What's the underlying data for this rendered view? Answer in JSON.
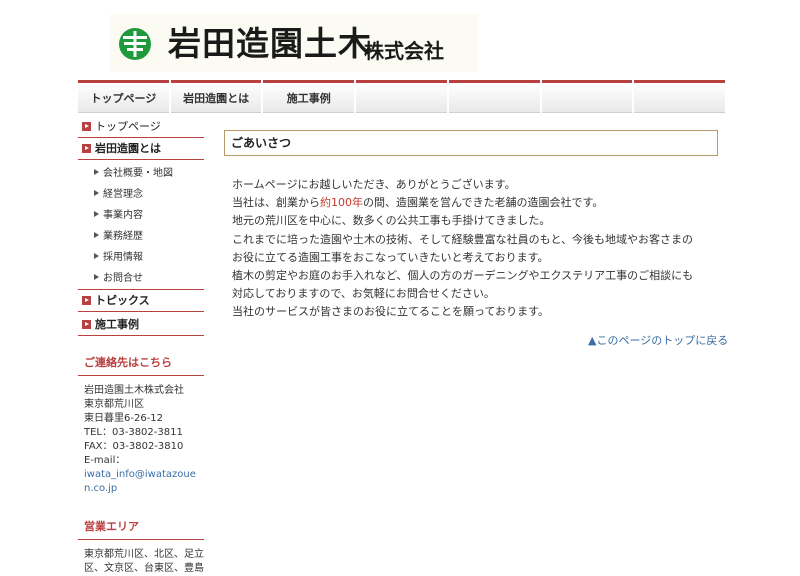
{
  "header": {
    "company_name": "岩田造園土木",
    "company_suffix": "株式会社",
    "logo_icon": "company-crest"
  },
  "nav": {
    "items": [
      "トップページ",
      "岩田造園とは",
      "施工事例",
      "",
      "",
      "",
      ""
    ]
  },
  "sidebar": {
    "links": [
      {
        "label": "トップページ",
        "bold": false
      },
      {
        "label": "岩田造園とは",
        "bold": true
      }
    ],
    "sub_links": [
      "会社概要・地図",
      "経営理念",
      "事業内容",
      "業務経歴",
      "採用情報",
      "お問合せ"
    ],
    "links_after": [
      {
        "label": "トピックス",
        "bold": true
      },
      {
        "label": "施工事例",
        "bold": true
      }
    ],
    "contact_heading": "ご連絡先はこちら",
    "contact_lines": [
      "岩田造園土木株式会社",
      "東京都荒川区",
      "東日暮里6-26-12",
      "TEL：03-3802-3811",
      "FAX：03-3802-3810",
      "E-mail："
    ],
    "contact_email": "iwata_info@iwatazouen.co.jp",
    "area_heading": "営業エリア",
    "area_text": "東京都荒川区、北区、足立区、文京区、台東区、豊島"
  },
  "main": {
    "title": "ごあいさつ",
    "para1_line1": "ホームページにお越しいただき、ありがとうございます。",
    "para1_line2_pre": "当社は、創業から",
    "para1_line2_hl": "約100年",
    "para1_line2_post": "の間、造園業を営んできた老舗の造園会社です。",
    "lines": [
      "地元の荒川区を中心に、数多くの公共工事も手掛けてきました。",
      "これまでに培った造園や土木の技術、そして経験豊富な社員のもと、今後も地域やお客さまの",
      "お役に立てる造園工事をおこなっていきたいと考えております。",
      "植木の剪定やお庭のお手入れなど、個人の方のガーデニングやエクステリア工事のご相談にも",
      "対応しておりますので、お気軽にお問合せください。",
      "当社のサービスが皆さまのお役に立てることを願っております。"
    ],
    "to_top": "▲このページのトップに戻る"
  },
  "colors": {
    "accent": "#b8413f",
    "link": "#3a6ea5",
    "highlight": "#c0392b",
    "logo_green": "#1e9a3c"
  }
}
